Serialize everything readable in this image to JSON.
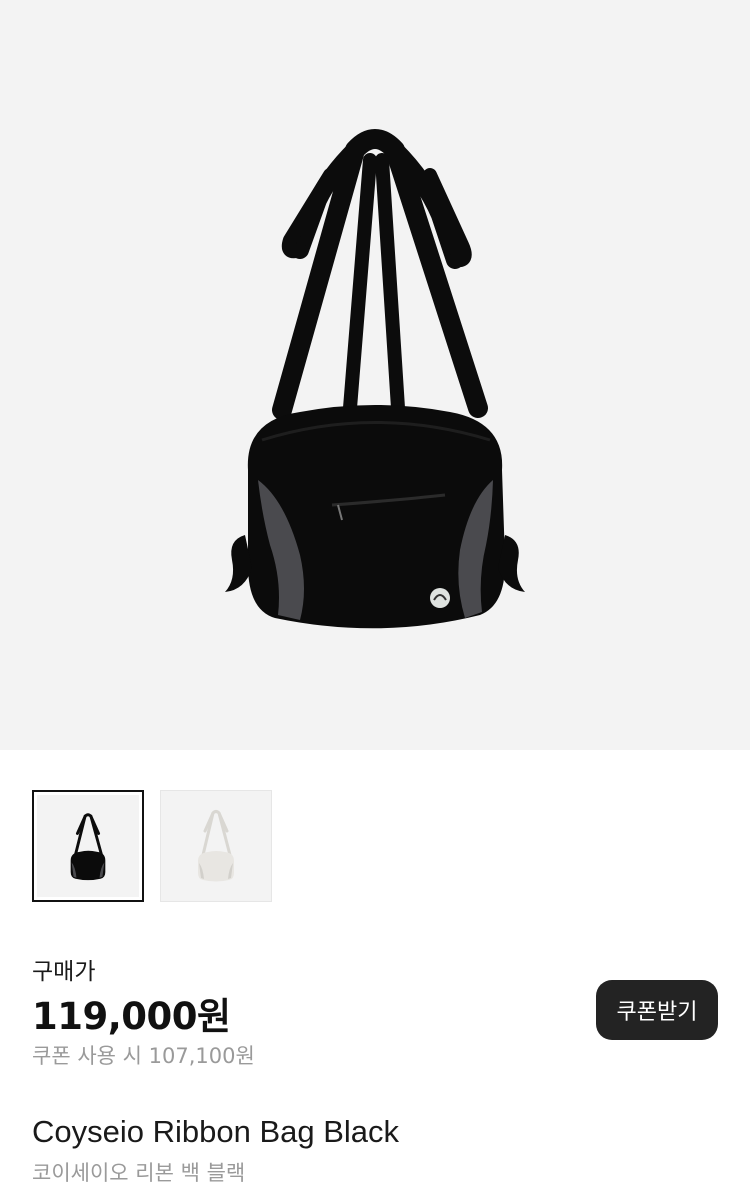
{
  "gallery": {
    "main_image": "black-ribbon-bag-photo",
    "thumbnails": [
      {
        "name": "black-bag-thumbnail",
        "selected": true,
        "color": "#111111"
      },
      {
        "name": "white-bag-thumbnail",
        "selected": false,
        "color": "#e8e6e2"
      }
    ]
  },
  "pricing": {
    "label": "구매가",
    "price": "119,000원",
    "coupon_price": "쿠폰 사용 시 107,100원",
    "coupon_button": "쿠폰받기"
  },
  "product": {
    "name_en": "Coyseio Ribbon Bag Black",
    "name_ko": "코이세이오 리본 백 블랙"
  },
  "colors": {
    "background": "#ffffff",
    "image_bg": "#f3f3f3",
    "button_bg": "#232323",
    "muted_text": "#9a9a9a"
  }
}
